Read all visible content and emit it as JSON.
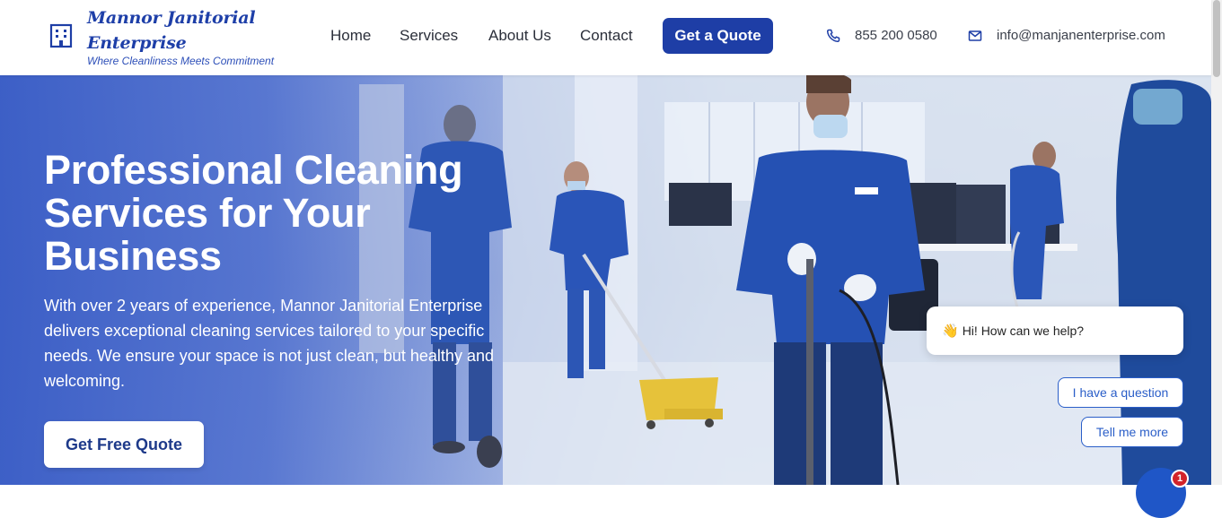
{
  "brand": {
    "name": "Mannor Janitorial Enterprise",
    "tagline": "Where Cleanliness Meets Commitment",
    "logo_icon": "building-icon"
  },
  "nav": {
    "items": [
      "Home",
      "Services",
      "About Us",
      "Contact"
    ],
    "quote_label": "Get a Quote"
  },
  "contact": {
    "phone": "855 200 0580",
    "phone_icon": "phone-icon",
    "email": "info@manjanenterprise.com",
    "email_icon": "mail-icon"
  },
  "hero": {
    "title": "Professional Cleaning Services for Your Business",
    "description": "With over 2 years of experience, Mannor Janitorial Enterprise delivers exceptional cleaning services tailored to your specific needs. We ensure your space is not just clean, but healthy and welcoming.",
    "cta_label": "Get Free Quote"
  },
  "chat": {
    "greeting_emoji": "👋",
    "greeting": "Hi! How can we help?",
    "options": [
      "I have a question",
      "Tell me more"
    ],
    "badge_count": "1"
  },
  "colors": {
    "brand_blue": "#1e3ea6",
    "hero_overlay": "#3458c4",
    "chat_blue": "#2a5ec8",
    "badge_red": "#d2232a"
  }
}
